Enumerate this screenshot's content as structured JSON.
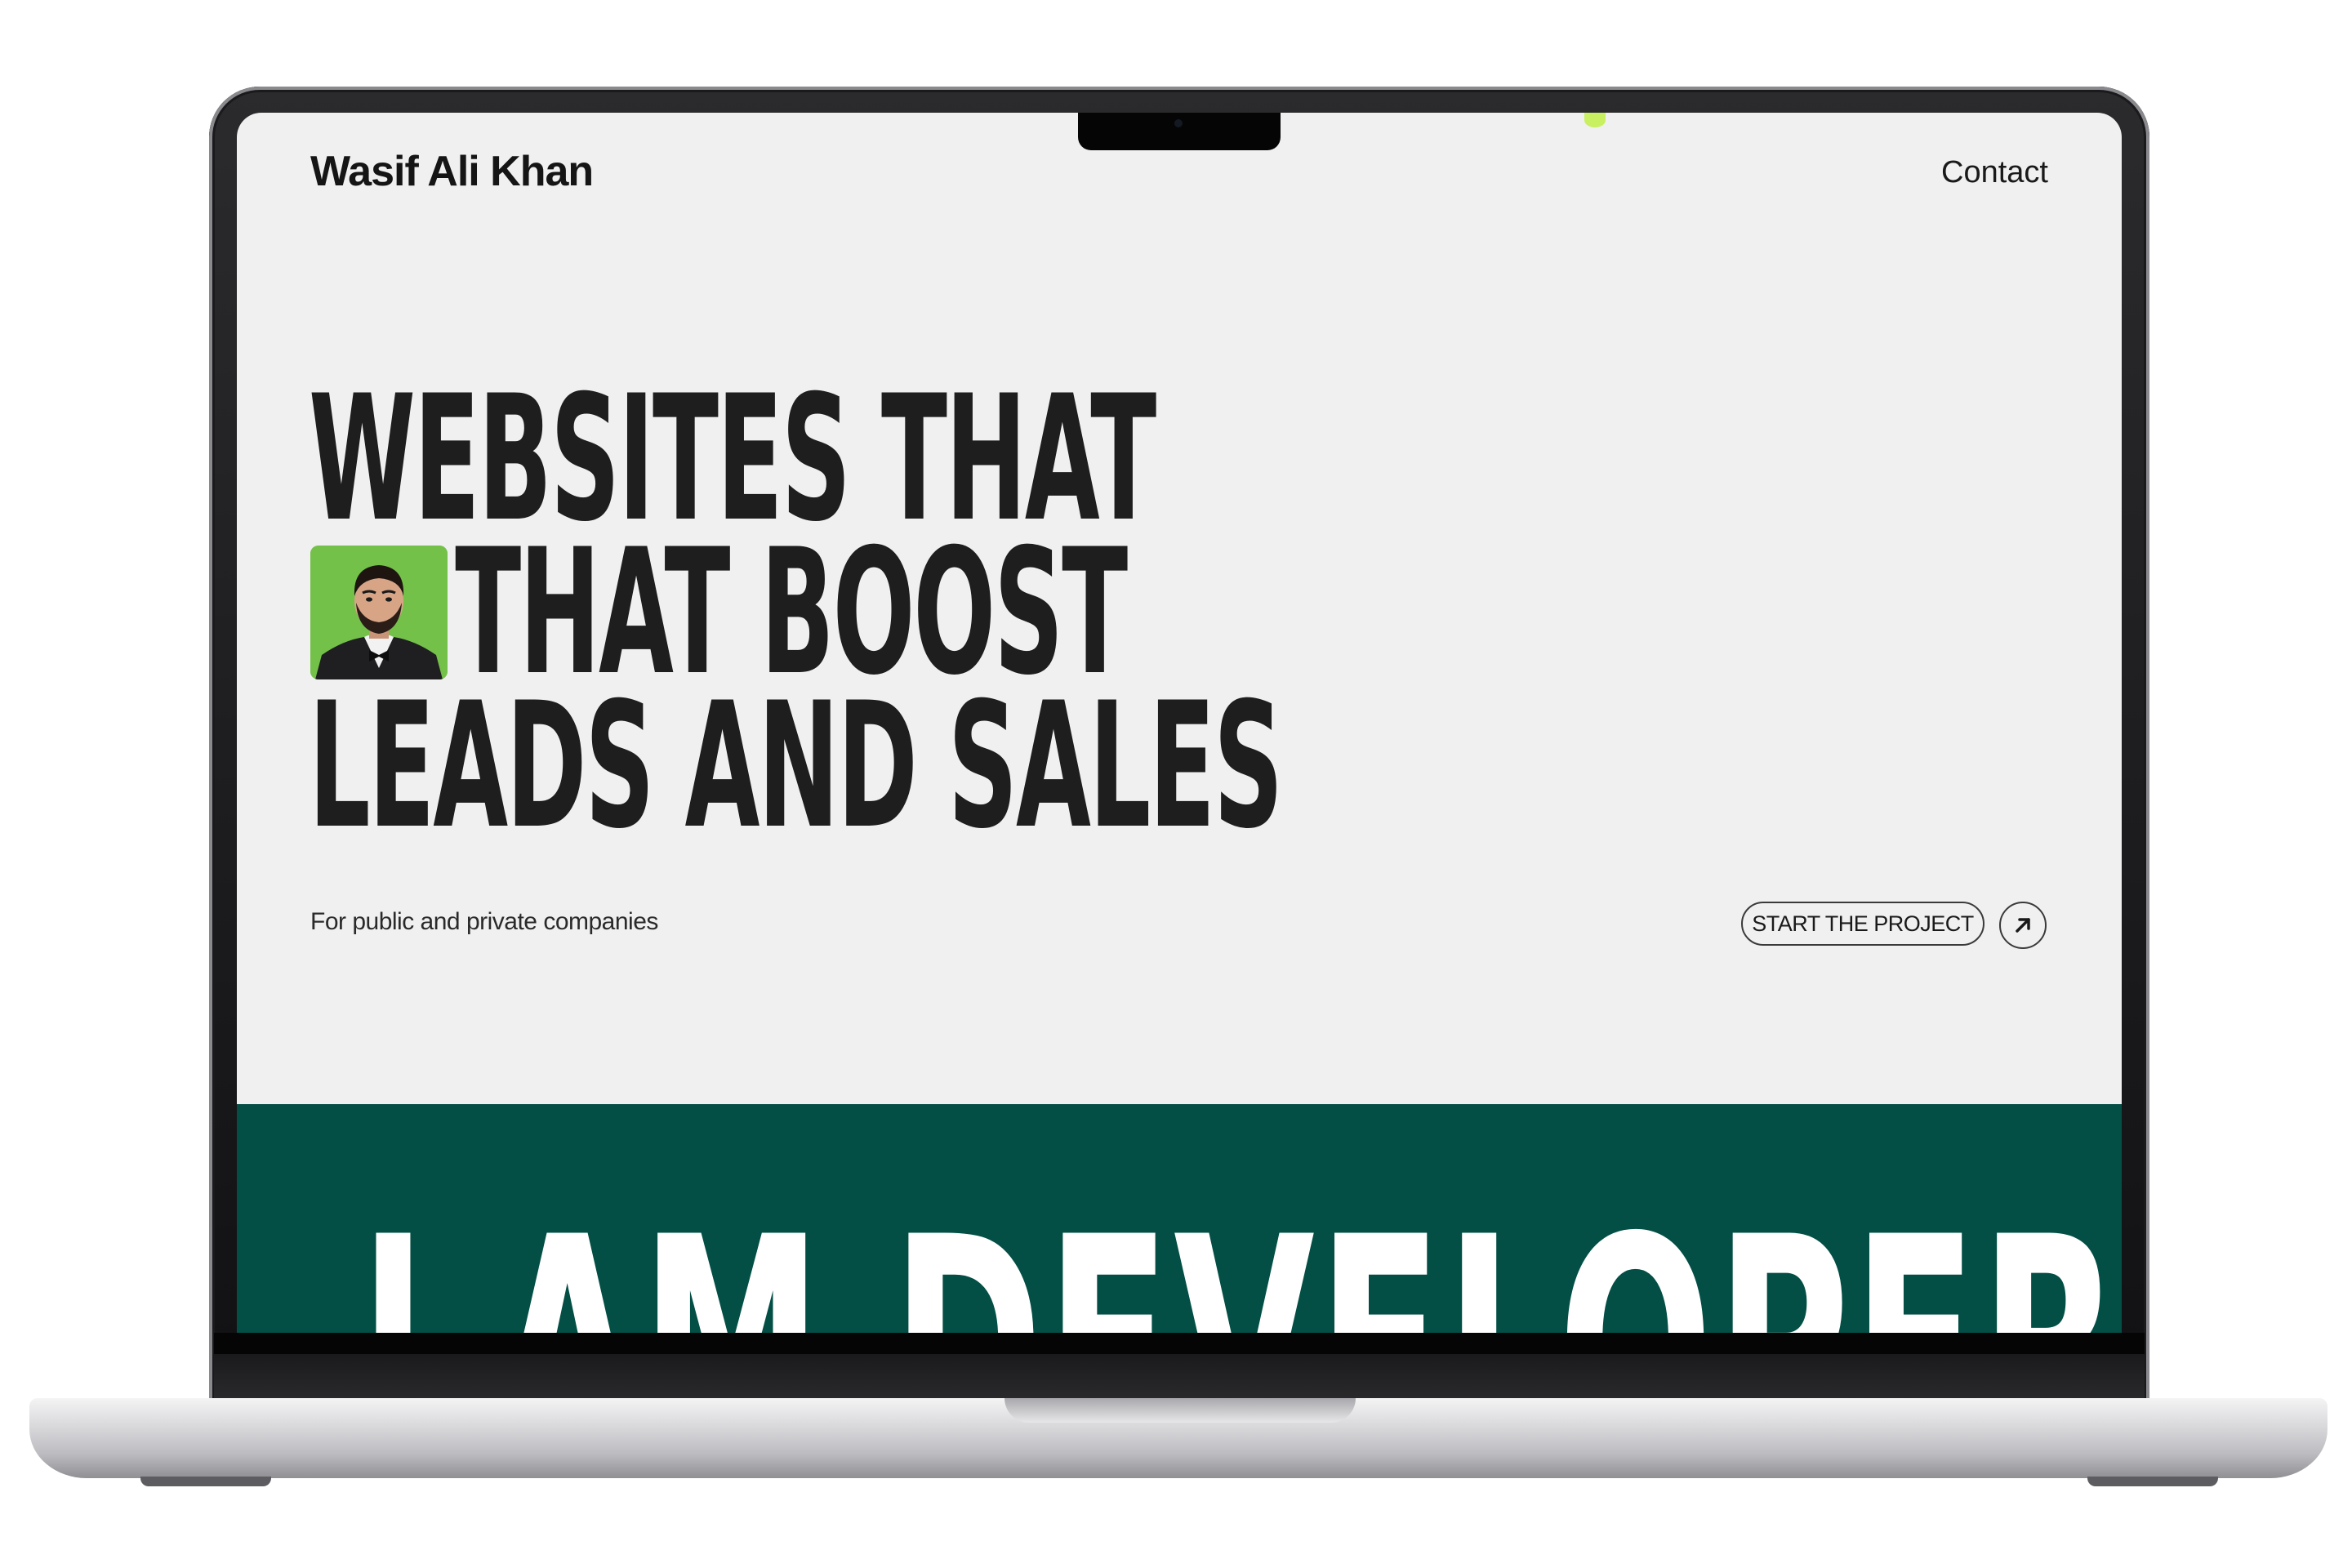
{
  "site": {
    "brand": "Wasif Ali Khan",
    "nav": {
      "contact_label": "Contact"
    },
    "hero": {
      "line1": "WEBSITES THAT",
      "line2": "THAT BOOST",
      "line3": "LEADS AND SALES",
      "avatar_icon": "person-portrait-icon"
    },
    "subheading": "For public and private companies",
    "cta": {
      "label": "START THE PROJECT",
      "arrow_icon": "arrow-up-right-icon"
    },
    "marquee_text": "I AM DEVELOPER"
  },
  "colors": {
    "background": "#f0f0f0",
    "text": "#1e1e1e",
    "band": "#034f45",
    "avatar_bg": "#74c14a",
    "accent_dot": "#c8f060"
  }
}
